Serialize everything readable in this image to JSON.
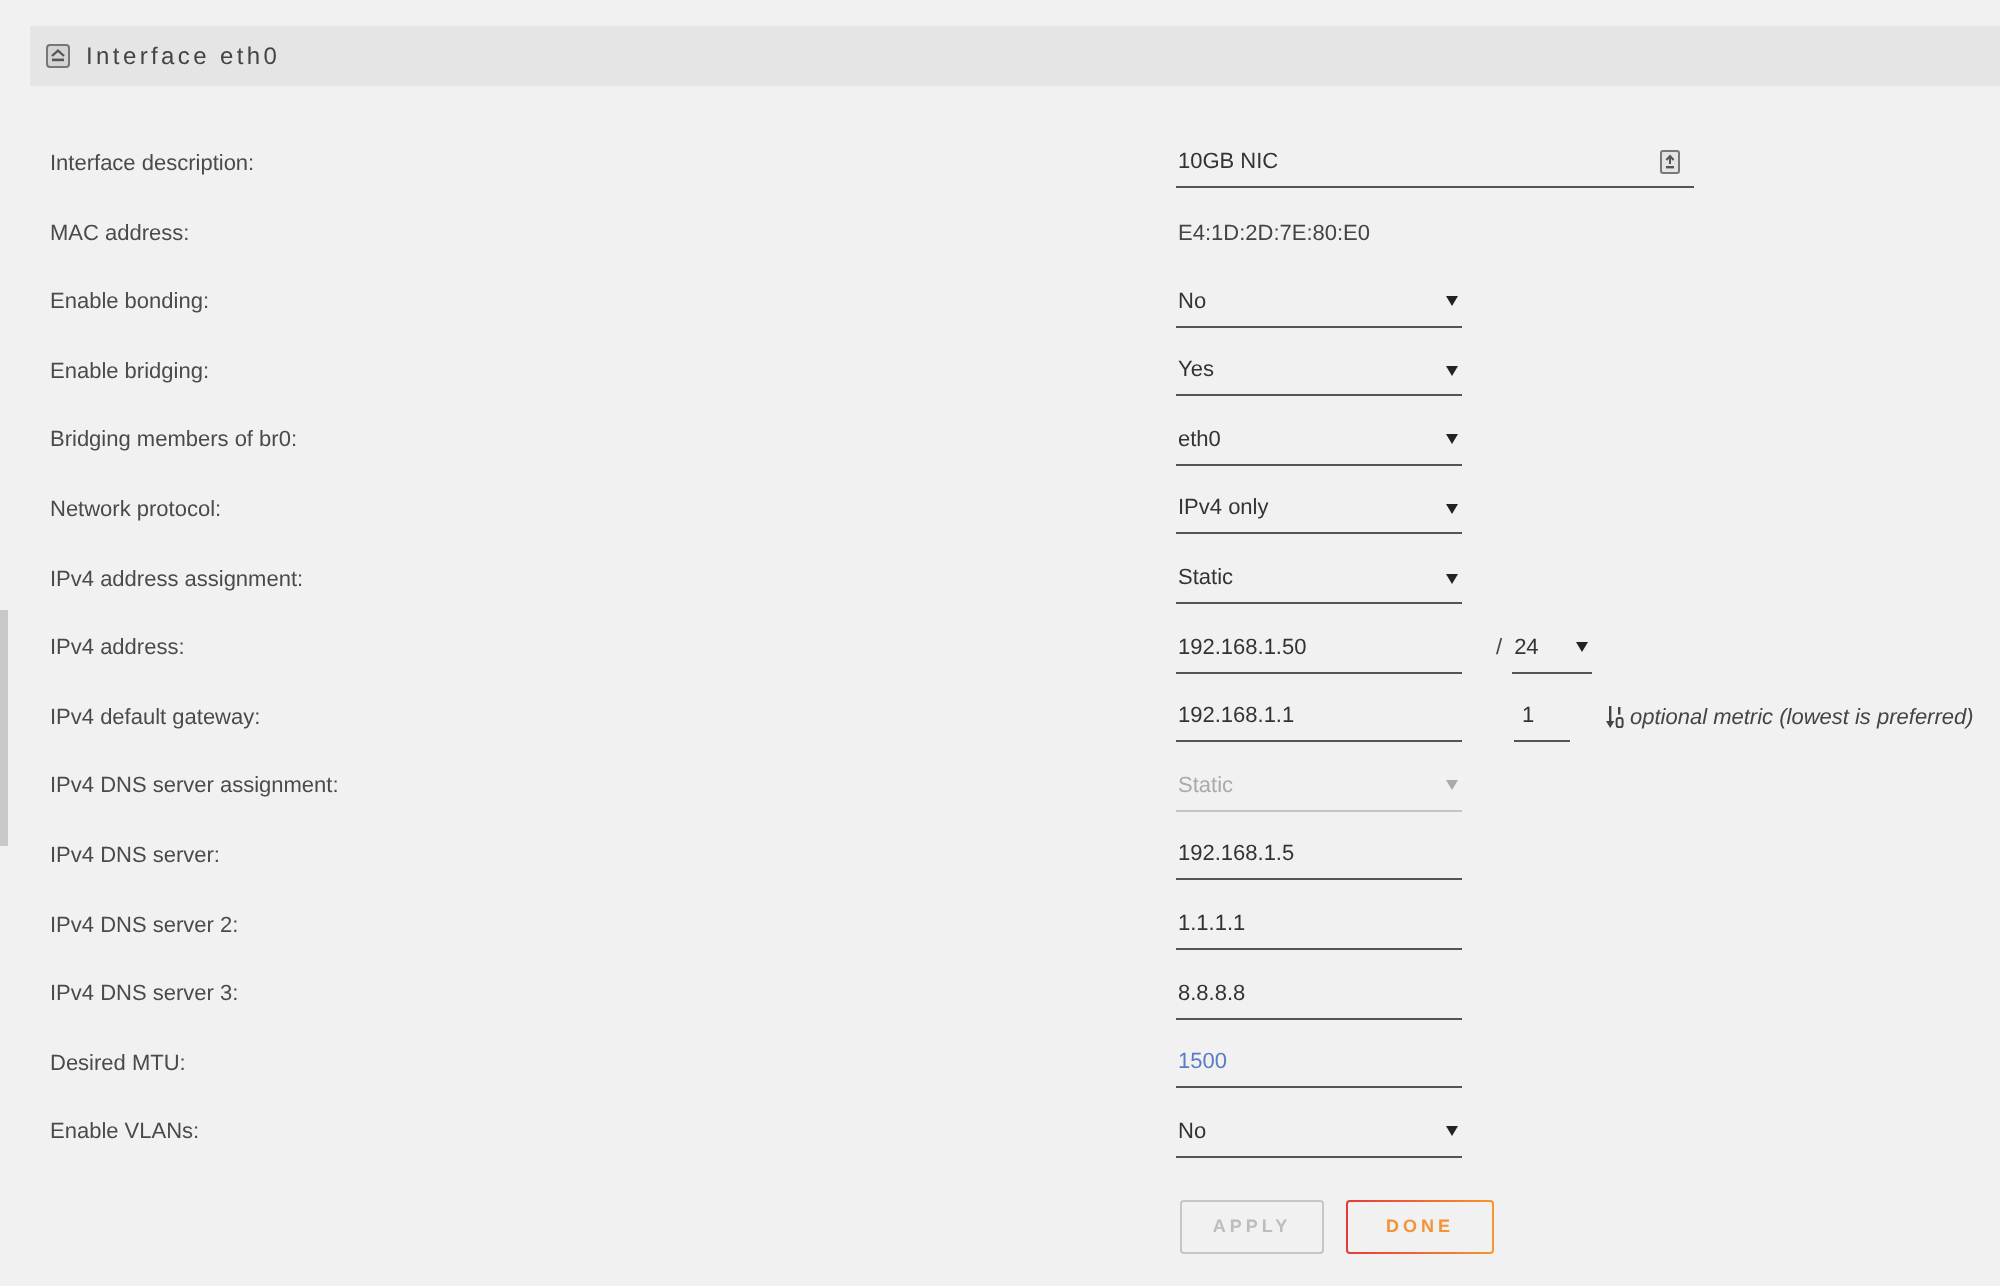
{
  "panel": {
    "title": "Interface eth0"
  },
  "fields": [
    {
      "label": "Interface description:",
      "kind": "text_with_button",
      "value": "10GB NIC",
      "disabled": false
    },
    {
      "label": "MAC address:",
      "kind": "static",
      "value": "E4:1D:2D:7E:80:E0",
      "disabled": false
    },
    {
      "label": "Enable bonding:",
      "kind": "select",
      "value": "No",
      "disabled": false
    },
    {
      "label": "Enable bridging:",
      "kind": "select",
      "value": "Yes",
      "disabled": false
    },
    {
      "label": "Bridging members of br0:",
      "kind": "select",
      "value": "eth0",
      "disabled": false
    },
    {
      "label": "Network protocol:",
      "kind": "select",
      "value": "IPv4 only",
      "disabled": false
    },
    {
      "label": "IPv4 address assignment:",
      "kind": "select",
      "value": "Static",
      "disabled": false
    },
    {
      "label": "IPv4 address:",
      "kind": "text",
      "value": "192.168.1.50",
      "disabled": false,
      "suffix": {
        "kind": "select",
        "separator": "/",
        "value": "24"
      }
    },
    {
      "label": "IPv4 default gateway:",
      "kind": "text",
      "value": "192.168.1.1",
      "disabled": false,
      "suffix": {
        "kind": "text",
        "value": "1",
        "hint": "optional metric (lowest is preferred)"
      }
    },
    {
      "label": "IPv4 DNS server assignment:",
      "kind": "select",
      "value": "Static",
      "disabled": true
    },
    {
      "label": "IPv4 DNS server:",
      "kind": "text",
      "value": "192.168.1.5",
      "disabled": false
    },
    {
      "label": "IPv4 DNS server 2:",
      "kind": "text",
      "value": "1.1.1.1",
      "disabled": false
    },
    {
      "label": "IPv4 DNS server 3:",
      "kind": "text",
      "value": "8.8.8.8",
      "disabled": false
    },
    {
      "label": "Desired MTU:",
      "kind": "text",
      "placeholder": "1500",
      "disabled": false
    },
    {
      "label": "Enable VLANs:",
      "kind": "select",
      "value": "No",
      "disabled": false
    }
  ],
  "buttons": [
    {
      "label": "APPLY",
      "kind": "secondary",
      "disabled": true
    },
    {
      "label": "DONE",
      "kind": "primary",
      "disabled": false
    }
  ]
}
